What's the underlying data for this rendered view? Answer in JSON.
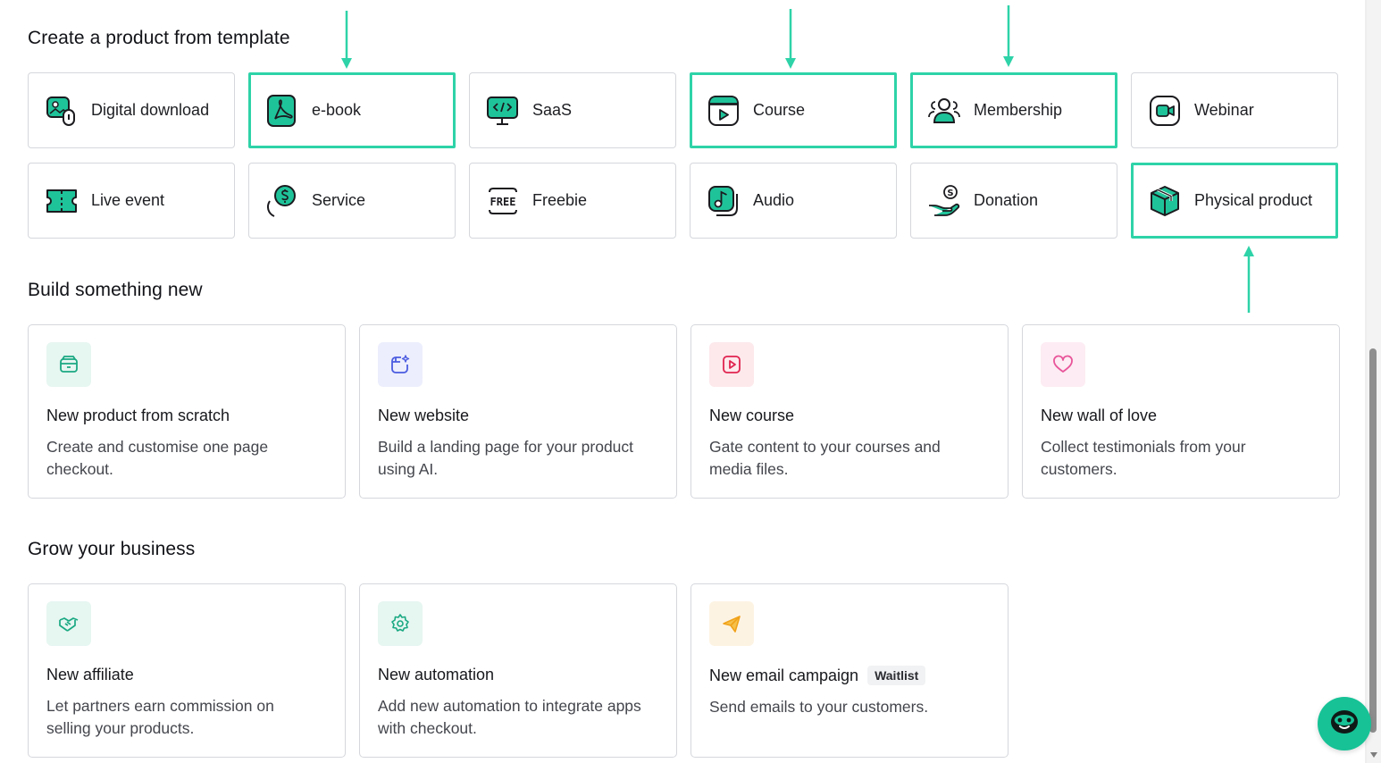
{
  "sections": {
    "templates_title": "Create a product from template",
    "build_title": "Build something new",
    "grow_title": "Grow your business"
  },
  "templates": [
    {
      "label": "Digital download",
      "icon": "digital-download-icon",
      "highlight": false
    },
    {
      "label": "e-book",
      "icon": "pdf-icon",
      "highlight": true
    },
    {
      "label": "SaaS",
      "icon": "code-monitor-icon",
      "highlight": false
    },
    {
      "label": "Course",
      "icon": "course-play-icon",
      "highlight": true
    },
    {
      "label": "Membership",
      "icon": "membership-people-icon",
      "highlight": true
    },
    {
      "label": "Webinar",
      "icon": "video-camera-icon",
      "highlight": false
    },
    {
      "label": "Live event",
      "icon": "ticket-icon",
      "highlight": false
    },
    {
      "label": "Service",
      "icon": "dollar-hand-icon",
      "highlight": false
    },
    {
      "label": "Freebie",
      "icon": "free-tag-icon",
      "highlight": false
    },
    {
      "label": "Audio",
      "icon": "music-note-icon",
      "highlight": false
    },
    {
      "label": "Donation",
      "icon": "donation-hand-icon",
      "highlight": false
    },
    {
      "label": "Physical product",
      "icon": "box-icon",
      "highlight": true
    }
  ],
  "build": [
    {
      "title": "New product from scratch",
      "desc": "Create and customise one page checkout.",
      "icon": "package-icon",
      "bg": "#e6f6f1",
      "color": "#1aa982"
    },
    {
      "title": "New website",
      "desc": "Build a landing page for your product using AI.",
      "icon": "website-sparkle-icon",
      "bg": "#eceefd",
      "color": "#4a5be0"
    },
    {
      "title": "New course",
      "desc": "Gate content to your courses and media files.",
      "icon": "play-square-icon",
      "bg": "#fde8ec",
      "color": "#e0234e"
    },
    {
      "title": "New wall of love",
      "desc": "Collect testimonials from your customers.",
      "icon": "heart-icon",
      "bg": "#fdecf3",
      "color": "#e8559a"
    }
  ],
  "grow": [
    {
      "title": "New affiliate",
      "desc": "Let partners earn commission on selling your products.",
      "icon": "handshake-icon",
      "bg": "#e6f6f1",
      "color": "#1aa982"
    },
    {
      "title": "New automation",
      "desc": "Add new automation to integrate apps with checkout.",
      "icon": "gear-icon",
      "bg": "#e6f6f1",
      "color": "#1aa982"
    },
    {
      "title": "New email campaign",
      "desc": "Send emails to your customers.",
      "icon": "paper-plane-icon",
      "bg": "#fdf3e3",
      "color": "#f0a21a",
      "badge": "Waitlist"
    }
  ],
  "colors": {
    "highlight": "#2ed3a8",
    "accent": "#16c296",
    "icon_fill": "#1fc39a"
  },
  "chat": {
    "icon": "chat-face-icon"
  }
}
